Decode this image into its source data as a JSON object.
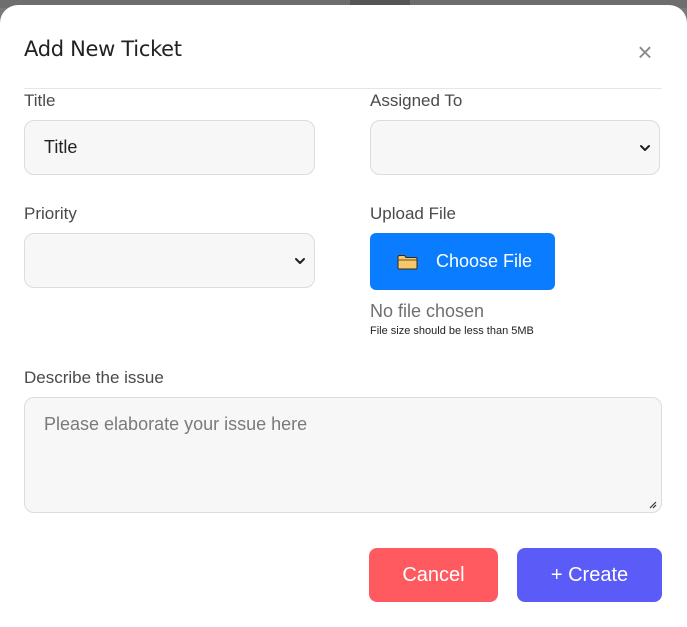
{
  "modal": {
    "title": "Add New Ticket",
    "close_symbol": "×",
    "close_icon": "close-icon"
  },
  "form": {
    "title": {
      "label": "Title",
      "value": "Title"
    },
    "assigned_to": {
      "label": "Assigned To",
      "value": ""
    },
    "priority": {
      "label": "Priority",
      "value": ""
    },
    "upload": {
      "label": "Upload File",
      "button_label": "Choose File",
      "button_icon": "folder-icon",
      "status": "No file chosen",
      "hint": "File size should be less than 5MB"
    },
    "description": {
      "label": "Describe the issue",
      "placeholder": "Please elaborate your issue here",
      "value": ""
    }
  },
  "actions": {
    "cancel_label": "Cancel",
    "create_label": "+ Create"
  },
  "colors": {
    "cancel": "#ff5a5f",
    "create": "#5b5bf7",
    "upload": "#0a7cff"
  }
}
